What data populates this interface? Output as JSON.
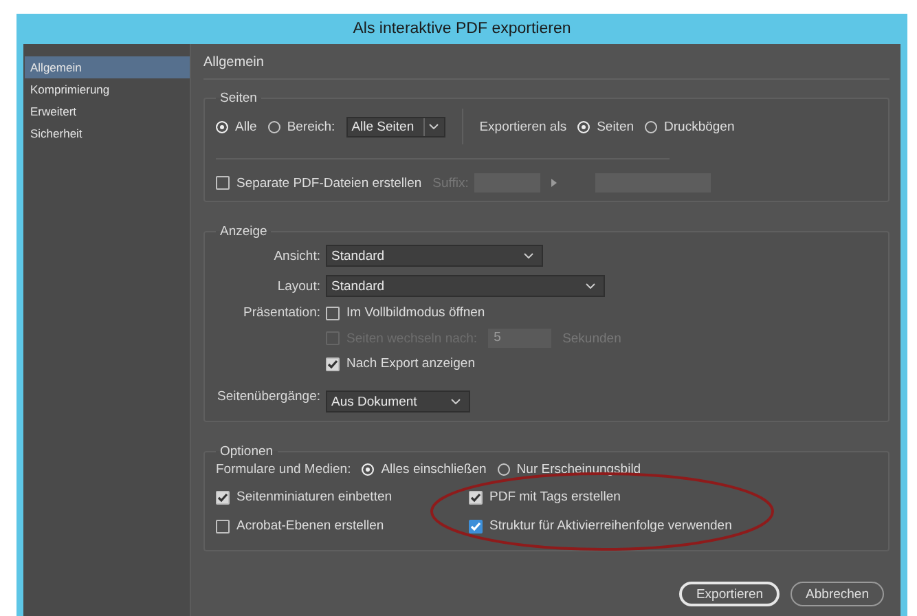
{
  "window": {
    "title": "Als interaktive PDF exportieren"
  },
  "sidebar": {
    "items": [
      {
        "label": "Allgemein",
        "selected": true
      },
      {
        "label": "Komprimierung",
        "selected": false
      },
      {
        "label": "Erweitert",
        "selected": false
      },
      {
        "label": "Sicherheit",
        "selected": false
      }
    ]
  },
  "page_heading": "Allgemein",
  "seiten": {
    "legend": "Seiten",
    "range_options": [
      {
        "label": "Alle",
        "selected": true
      },
      {
        "label": "Bereich:",
        "selected": false
      }
    ],
    "range_field": {
      "value": "Alle Seiten"
    },
    "export_as_label": "Exportieren als",
    "export_as_options": [
      {
        "label": "Seiten",
        "selected": true
      },
      {
        "label": "Druckbögen",
        "selected": false
      }
    ],
    "separate": {
      "label": "Separate PDF-Dateien erstellen",
      "checked": false
    },
    "suffix_label": "Suffix:"
  },
  "anzeige": {
    "legend": "Anzeige",
    "dropdowns": [
      {
        "label": "Ansicht:",
        "value": "Standard"
      },
      {
        "label": "Layout:",
        "value": "Standard"
      }
    ],
    "presentation_label": "Präsentation:",
    "fullscreen": {
      "label": "Im Vollbildmodus öffnen",
      "checked": false
    },
    "page_switch": {
      "label": "Seiten wechseln nach:",
      "checked": false,
      "disabled": true,
      "value": "5",
      "unit": "Sekunden"
    },
    "show_after": {
      "label": "Nach Export anzeigen",
      "checked": true
    },
    "transitions": {
      "label": "Seitenübergänge:",
      "value": "Aus Dokument"
    }
  },
  "optionen": {
    "legend": "Optionen",
    "forms_label": "Formulare und Medien:",
    "forms_options": [
      {
        "label": "Alles einschließen",
        "selected": true
      },
      {
        "label": "Nur Erscheinungsbild",
        "selected": false
      }
    ],
    "checks": [
      {
        "label": "Seitenminiaturen einbetten",
        "checked": true,
        "focused": false
      },
      {
        "label": "PDF mit Tags erstellen",
        "checked": true,
        "focused": false
      },
      {
        "label": "Acrobat-Ebenen erstellen",
        "checked": false,
        "focused": false
      },
      {
        "label": "Struktur für Aktivierreihenfolge verwenden",
        "checked": true,
        "focused": true
      }
    ]
  },
  "buttons": [
    {
      "label": "Exportieren",
      "default": true
    },
    {
      "label": "Abbrechen",
      "default": false
    }
  ]
}
